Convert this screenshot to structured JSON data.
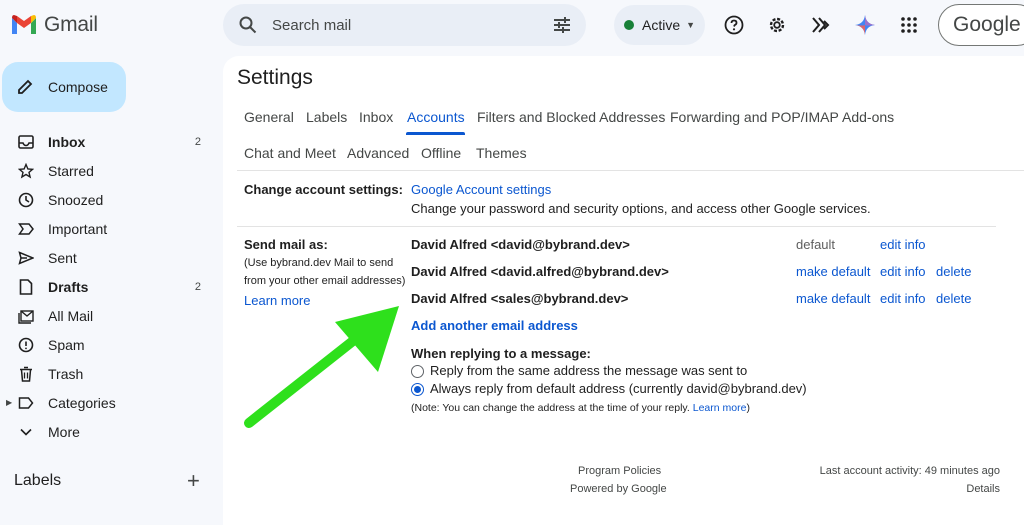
{
  "app": {
    "name": "Gmail"
  },
  "search": {
    "placeholder": "Search mail"
  },
  "status": {
    "label": "Active"
  },
  "header": {
    "account_logo": "Google"
  },
  "colors": {
    "accent": "#0b57d0",
    "compose_bg": "#c2e7ff",
    "active_dot": "#188038",
    "arrow": "#2ee01c"
  },
  "compose": {
    "label": "Compose"
  },
  "nav": [
    {
      "label": "Inbox",
      "count": "2",
      "icon": "inbox-icon"
    },
    {
      "label": "Starred",
      "count": "",
      "icon": "star-icon"
    },
    {
      "label": "Snoozed",
      "count": "",
      "icon": "clock-icon"
    },
    {
      "label": "Important",
      "count": "",
      "icon": "important-icon"
    },
    {
      "label": "Sent",
      "count": "",
      "icon": "send-icon"
    },
    {
      "label": "Drafts",
      "count": "2",
      "icon": "draft-icon"
    },
    {
      "label": "All Mail",
      "count": "",
      "icon": "all-mail-icon"
    },
    {
      "label": "Spam",
      "count": "",
      "icon": "spam-icon"
    },
    {
      "label": "Trash",
      "count": "",
      "icon": "trash-icon"
    },
    {
      "label": "Categories",
      "count": "",
      "icon": "label-icon"
    },
    {
      "label": "More",
      "count": "",
      "icon": "chevron-down-icon"
    }
  ],
  "labels": {
    "heading": "Labels"
  },
  "settings": {
    "title": "Settings",
    "tabs": [
      "General",
      "Labels",
      "Inbox",
      "Accounts",
      "Filters and Blocked Addresses",
      "Forwarding and POP/IMAP",
      "Add-ons",
      "Chat and Meet",
      "Advanced",
      "Offline",
      "Themes"
    ],
    "active_tab": "Accounts",
    "change_account": {
      "label": "Change account settings:",
      "link": "Google Account settings",
      "desc": "Change your password and security options, and access other Google services."
    },
    "send_mail": {
      "label": "Send mail as:",
      "help_1": "(Use bybrand.dev Mail to send",
      "help_2": "from your other email addresses)",
      "learn_more": "Learn more",
      "addresses": [
        {
          "address": "David Alfred <david@bybrand.dev>",
          "status": "default",
          "edit": "edit info",
          "delete": ""
        },
        {
          "address": "David Alfred <david.alfred@bybrand.dev>",
          "status": "make default",
          "edit": "edit info",
          "delete": "delete"
        },
        {
          "address": "David Alfred <sales@bybrand.dev>",
          "status": "make default",
          "edit": "edit info",
          "delete": "delete"
        }
      ],
      "add_another": "Add another email address",
      "reply_heading": "When replying to a message:",
      "reply_options": [
        {
          "label": "Reply from the same address the message was sent to",
          "selected": false
        },
        {
          "label": "Always reply from default address (currently david@bybrand.dev)",
          "selected": true
        }
      ],
      "note": "(Note: You can change the address at the time of your reply.",
      "note_link": "Learn more",
      "note_close": ")"
    }
  },
  "footer": {
    "program_policies": "Program Policies",
    "powered_by": "Powered by Google",
    "last_activity": "Last account activity: 49 minutes ago",
    "details": "Details"
  }
}
